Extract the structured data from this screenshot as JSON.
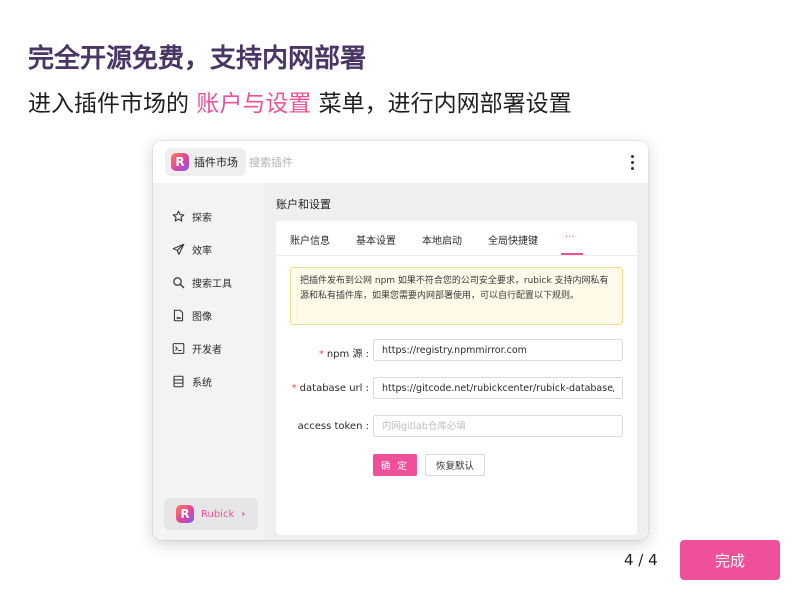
{
  "headline": "完全开源免费，支持内网部署",
  "subline": {
    "prefix": "进入插件市场的 ",
    "highlight": "账户与设置",
    "suffix": " 菜单，进行内网部署设置"
  },
  "window": {
    "app_name": "插件市场",
    "search_placeholder": "搜索插件",
    "sidebar": {
      "items": [
        {
          "label": "探索",
          "icon": "star-icon"
        },
        {
          "label": "效率",
          "icon": "send-icon"
        },
        {
          "label": "搜索工具",
          "icon": "search-icon"
        },
        {
          "label": "图像",
          "icon": "image-file-icon"
        },
        {
          "label": "开发者",
          "icon": "terminal-icon"
        },
        {
          "label": "系统",
          "icon": "system-icon"
        }
      ],
      "user": {
        "name": "Rubick",
        "chevron": "›"
      }
    },
    "content": {
      "title": "账户和设置",
      "tabs": [
        "账户信息",
        "基本设置",
        "本地启动",
        "全局快捷键",
        "···"
      ],
      "active_tab_index": 4,
      "notice": "把插件发布到公网 npm 如果不符合您的公司安全要求，rubick 支持内网私有源和私有插件库，如果您需要内网部署使用，可以自行配置以下规则。",
      "form": {
        "npm": {
          "label": "npm 源 :",
          "required": true,
          "value": "https://registry.npmmirror.com"
        },
        "database": {
          "label": "database url :",
          "required": true,
          "value": "https://gitcode.net/rubickcenter/rubick-database/-/raw"
        },
        "token": {
          "label": "access token :",
          "required": false,
          "value": "",
          "placeholder": "内网gitlab仓库必填"
        },
        "confirm_label": "确 定",
        "reset_label": "恢复默认"
      }
    }
  },
  "pager": "4 / 4",
  "done_label": "完成",
  "colors": {
    "accent": "#f0509a",
    "headline": "#4a3566",
    "notice_bg": "#fffbe8",
    "notice_border": "#f5dc8f"
  }
}
